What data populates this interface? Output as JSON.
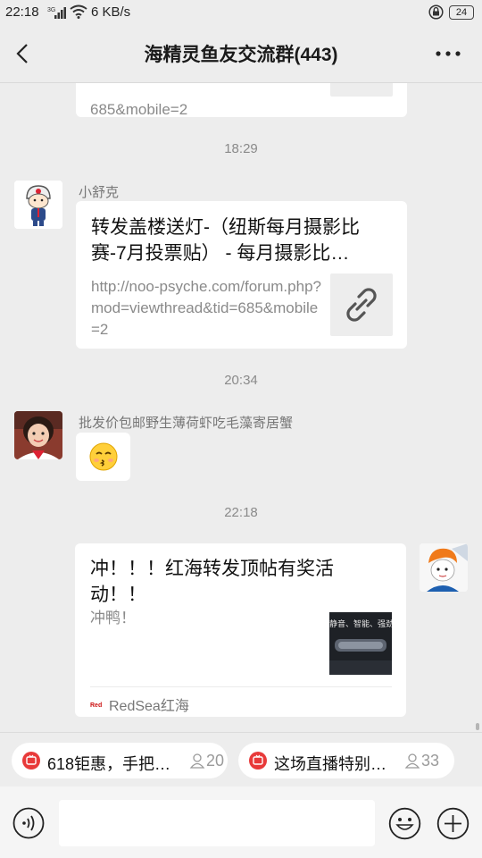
{
  "status_bar": {
    "time": "22:18",
    "network": "3G",
    "speed": "6 KB/s",
    "battery": "24"
  },
  "header": {
    "title": "海精灵鱼友交流群(443)"
  },
  "messages": {
    "top_card": {
      "url_tail": "685&mobile=2"
    },
    "ts1": "18:29",
    "msg1": {
      "sender": "小舒克",
      "title": "转发盖楼送灯-（纽斯每月摄影比赛-7月投票贴） - 每月摄影比…",
      "url": "http://noo-psyche.com/forum.php?mod=viewthread&tid=685&mobile=2"
    },
    "ts2": "20:34",
    "msg2": {
      "sender": "批发价包邮野生薄荷虾吃毛藻寄居蟹",
      "emoji": "😚"
    },
    "ts3": "22:18",
    "msg3": {
      "title": "冲！！！红海转发顶帖有奖活动！！",
      "desc": "冲鸭！",
      "thumb_text": "静音、智能、强劲",
      "source": "RedSea红海"
    }
  },
  "quick_bar": {
    "chips": [
      {
        "label": "618钜惠，手把…",
        "count": "20"
      },
      {
        "label": "这场直播特别…",
        "count": "33"
      }
    ]
  }
}
